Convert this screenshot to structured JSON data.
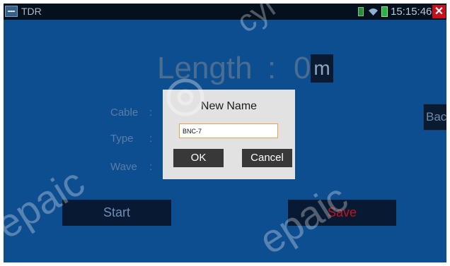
{
  "statusbar": {
    "app_title": "TDR",
    "clock": "15:15:46",
    "close_glyph": "✕",
    "icons": [
      "app-icon",
      "sd-card-icon",
      "wifi-icon",
      "battery-icon",
      "close-icon"
    ]
  },
  "main": {
    "length_label": "Length",
    "length_separator": ":",
    "length_value": "0",
    "length_unit": "m",
    "fields": [
      {
        "label": "Cable",
        "colon": ":"
      },
      {
        "label": "Type",
        "colon": ":"
      },
      {
        "label": "Wave",
        "colon": ":"
      }
    ],
    "start_label": "Start",
    "save_label": "Save",
    "back_label": "Back"
  },
  "dialog": {
    "title": "New Name",
    "input_value": "BNC-7",
    "ok_label": "OK",
    "cancel_label": "Cancel"
  },
  "watermark": {
    "text": "cyberpoint",
    "fragments": [
      "cyl",
      "epaic",
      "epaic"
    ]
  },
  "colors": {
    "screen_bg": "#0d4e90",
    "statusbar_bg": "#05101f",
    "dialog_bg": "#e2e2e2",
    "button_dark": "#383838",
    "input_focus": "#e8a24e",
    "close_red": "#c8101c",
    "save_text": "#c0111c"
  }
}
